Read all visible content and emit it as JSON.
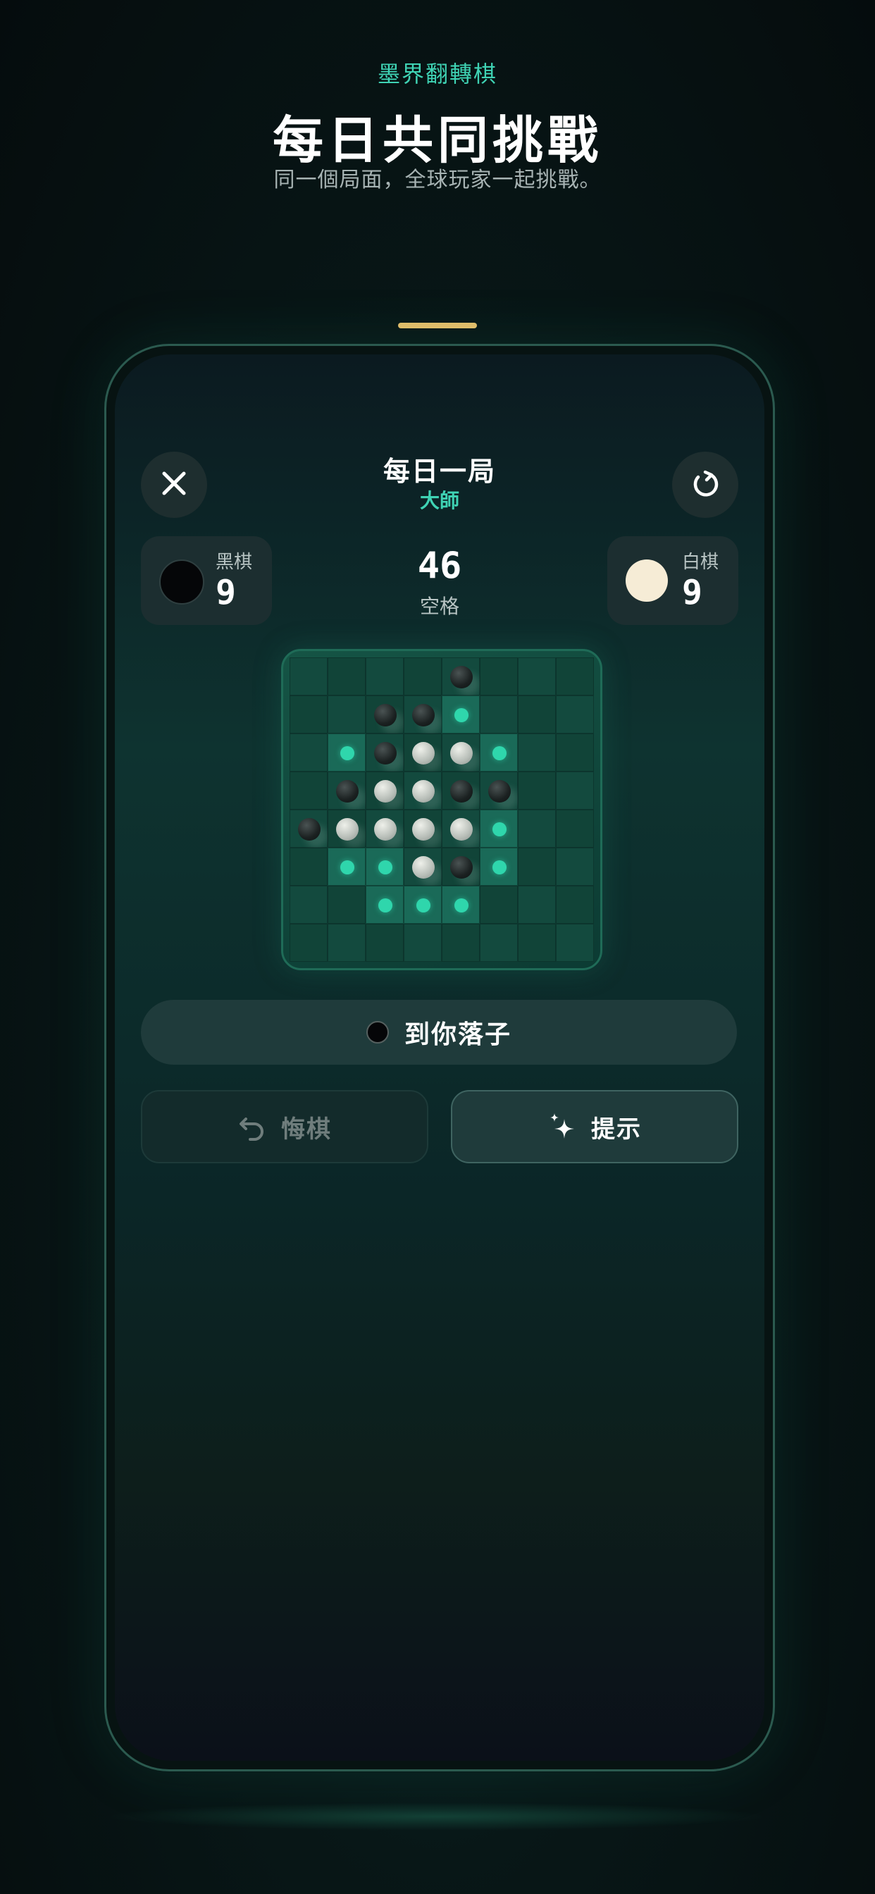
{
  "promo": {
    "eyebrow": "墨界翻轉棋",
    "title": "每日共同挑戰",
    "subtitle": "同一個局面，全球玩家一起挑戰。"
  },
  "header": {
    "title": "每日一局",
    "difficulty": "大師",
    "close_icon": "close-icon",
    "refresh_icon": "refresh-icon"
  },
  "scores": {
    "black": {
      "label": "黑棋",
      "value": "9"
    },
    "white": {
      "label": "白棋",
      "value": "9"
    },
    "empty": {
      "value": "46",
      "label": "空格"
    }
  },
  "board": {
    "size": 8,
    "rows": [
      "....B...",
      "..BBH...",
      ".HBWWH..",
      ".BWWBB..",
      "BWWWWH..",
      ".HHWBH..",
      "..HHH...",
      "........"
    ],
    "legend": {
      "B": "black",
      "W": "white",
      "H": "legal-move"
    }
  },
  "status": {
    "turn_text": "到你落子"
  },
  "actions": {
    "undo_label": "悔棋",
    "hint_label": "提示"
  },
  "colors": {
    "accent": "#3fd3b4",
    "handle": "#e9c06b",
    "hint_dot": "#2fd6ac"
  }
}
